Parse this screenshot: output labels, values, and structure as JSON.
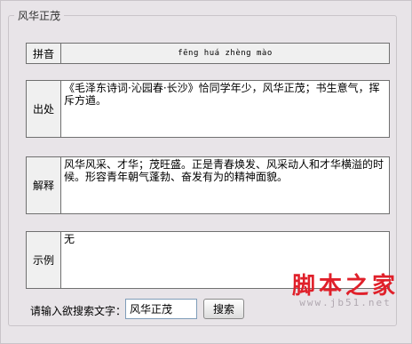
{
  "group": {
    "title": "风华正茂"
  },
  "rows": {
    "pinyin": {
      "label": "拼音",
      "value": "fēng huá zhèng mào"
    },
    "source": {
      "label": "出处",
      "value": "《毛泽东诗词·沁园春·长沙》恰同学年少，风华正茂；书生意气，挥斥方遒。"
    },
    "meaning": {
      "label": "解释",
      "value": "风华风采、才华；茂旺盛。正是青春焕发、风采动人和才华横溢的时候。形容青年朝气蓬勃、奋发有为的精神面貌。"
    },
    "example": {
      "label": "示例",
      "value": "无"
    }
  },
  "search": {
    "label": "请输入欲搜索文字：",
    "value": "风华正茂",
    "button": "搜索"
  },
  "watermark": {
    "title": "脚本之家",
    "url": "www.jb51.net"
  }
}
